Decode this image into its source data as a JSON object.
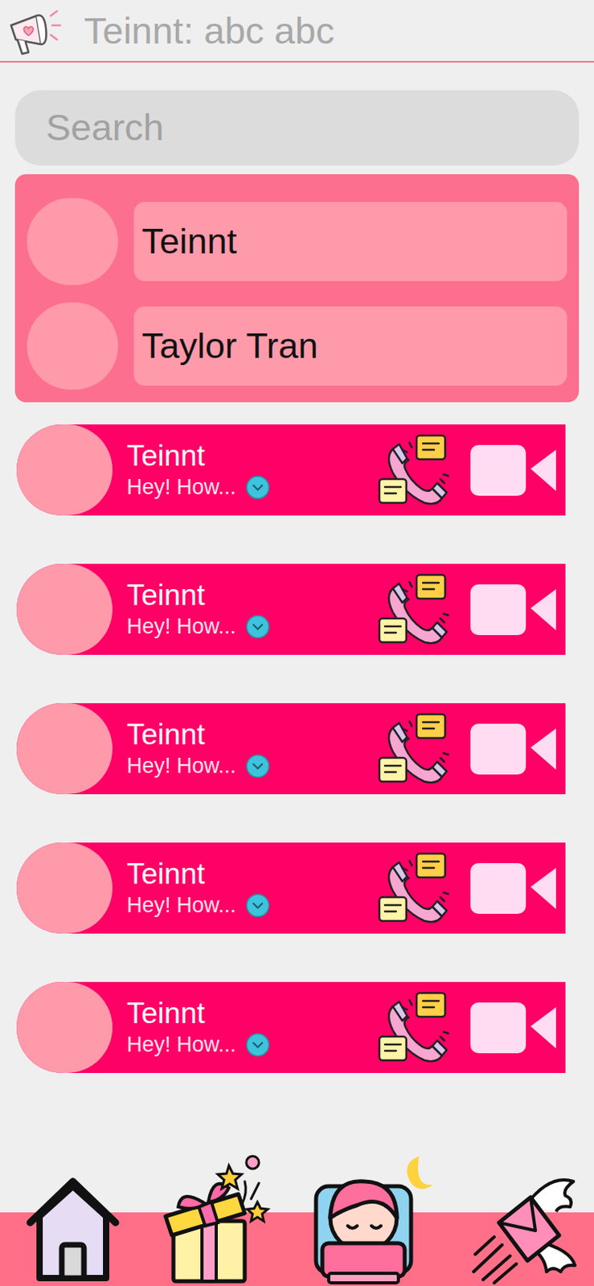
{
  "header": {
    "title": "Teinnt: abc abc"
  },
  "search": {
    "placeholder": "Search"
  },
  "contacts": [
    {
      "name": "Teinnt"
    },
    {
      "name": "Taylor Tran"
    }
  ],
  "chats": [
    {
      "name": "Teinnt",
      "preview": "Hey! How..."
    },
    {
      "name": "Teinnt",
      "preview": "Hey! How..."
    },
    {
      "name": "Teinnt",
      "preview": "Hey! How..."
    },
    {
      "name": "Teinnt",
      "preview": "Hey! How..."
    },
    {
      "name": "Teinnt",
      "preview": "Hey! How..."
    }
  ]
}
